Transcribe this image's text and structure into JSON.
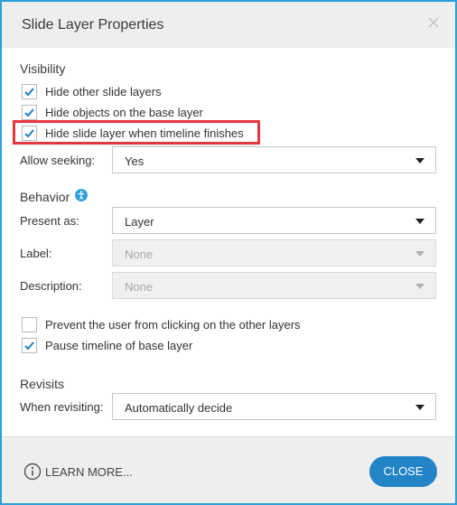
{
  "dialog": {
    "title": "Slide Layer Properties",
    "close_icon": "close-x-icon"
  },
  "visibility": {
    "heading": "Visibility",
    "options": [
      {
        "label": "Hide other slide layers",
        "checked": true
      },
      {
        "label": "Hide objects on the base layer",
        "checked": true
      },
      {
        "label": "Hide slide layer when timeline finishes",
        "checked": true
      }
    ],
    "allow_seeking_label": "Allow seeking:",
    "allow_seeking_value": "Yes"
  },
  "behavior": {
    "heading": "Behavior",
    "info_icon": "accessibility-info-icon",
    "present_as_label": "Present as:",
    "present_as_value": "Layer",
    "label_label": "Label:",
    "label_value": "None",
    "description_label": "Description:",
    "description_value": "None",
    "options": [
      {
        "label": "Prevent the user from clicking on the other layers",
        "checked": false
      },
      {
        "label": "Pause timeline of base layer",
        "checked": true
      }
    ]
  },
  "revisits": {
    "heading": "Revisits",
    "when_revisiting_label": "When revisiting:",
    "when_revisiting_value": "Automatically decide"
  },
  "footer": {
    "learn_more": "LEARN MORE...",
    "close_label": "CLOSE"
  },
  "colors": {
    "accent": "#2b9fd9",
    "button": "#2385c7",
    "highlight": "#e8353c",
    "check": "#1f7fc4"
  }
}
